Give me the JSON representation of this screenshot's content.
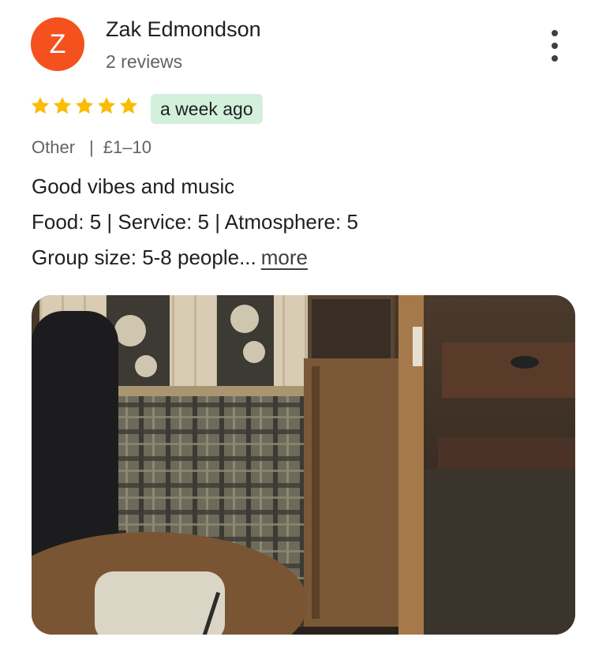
{
  "reviewer": {
    "initial": "Z",
    "name": "Zak Edmondson",
    "review_count": "2 reviews",
    "avatar_color": "#f4511e"
  },
  "rating": {
    "stars": 5,
    "max_stars": 5,
    "star_color": "#fbbc04",
    "time_ago": "a week ago"
  },
  "meta": {
    "category": "Other",
    "separator": "|",
    "price": "£1–10"
  },
  "review": {
    "text": "Good vibes and music",
    "scores": [
      {
        "label": "Food",
        "value": "5"
      },
      {
        "label": "Service",
        "value": "5"
      },
      {
        "label": "Atmosphere",
        "value": "5"
      }
    ],
    "group_size_label": "Group size",
    "group_size_value": "5-8 people...",
    "more_label": "more"
  },
  "photo": {
    "icon": "photo"
  },
  "menu_icon": "more-vert-icon"
}
